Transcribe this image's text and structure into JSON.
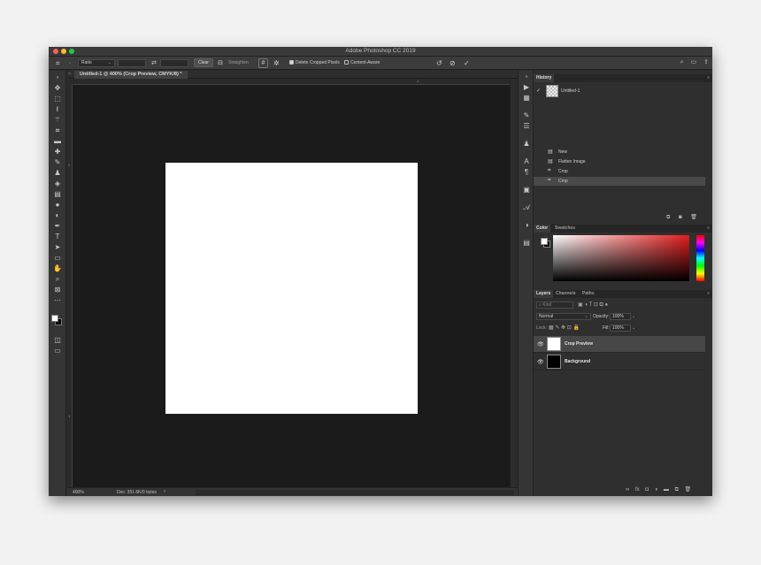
{
  "window": {
    "title": "Adobe Photoshop CC 2019"
  },
  "options_bar": {
    "ratio_label": "Ratio",
    "clear_label": "Clear",
    "straighten_label": "Straighten",
    "delete_cropped_label": "Delete Cropped Pixels",
    "delete_cropped_checked": true,
    "content_aware_label": "Content-Aware",
    "content_aware_checked": false
  },
  "document": {
    "tab_label": "Untitled-1 @ 400% (Crop Preview, CMYK/8) *",
    "ruler_h_mark": "1",
    "ruler_v_mark_top": "0",
    "ruler_v_mark_bottom": "1"
  },
  "status": {
    "zoom": "400%",
    "doc_size": "Doc: 351.6K/0 bytes"
  },
  "tools": [
    "move-tool-icon",
    "marquee-tool-icon",
    "lasso-tool-icon",
    "magic-wand-tool-icon",
    "crop-tool-icon",
    "ruler-tool-icon",
    "healing-brush-tool-icon",
    "brush-tool-icon",
    "clone-stamp-tool-icon",
    "eraser-tool-icon",
    "gradient-tool-icon",
    "blur-tool-icon",
    "dodge-tool-icon",
    "pen-tool-icon",
    "type-tool-icon",
    "path-selection-tool-icon",
    "rectangle-tool-icon",
    "hand-tool-icon",
    "zoom-tool-icon",
    "frame-tool-icon",
    "more-tools-icon"
  ],
  "history": {
    "title": "History",
    "snapshot_label": "Untitled-1",
    "items": [
      {
        "label": "New",
        "selected": false
      },
      {
        "label": "Flatten Image",
        "selected": false
      },
      {
        "label": "Crop",
        "selected": false
      },
      {
        "label": "Crop",
        "selected": true
      }
    ]
  },
  "color_panel": {
    "tab_color": "Color",
    "tab_swatches": "Swatches",
    "hue_color": "#e11c1c"
  },
  "layers_panel": {
    "tab_layers": "Layers",
    "tab_channels": "Channels",
    "tab_paths": "Paths",
    "filter_placeholder": "Kind",
    "blend_mode": "Normal",
    "opacity_label": "Opacity:",
    "opacity_value": "100%",
    "lock_label": "Lock:",
    "fill_label": "Fill:",
    "fill_value": "100%",
    "layers": [
      {
        "name": "Crop Preview",
        "thumb_color": "#ffffff",
        "selected": true
      },
      {
        "name": "Background",
        "thumb_color": "#000000",
        "selected": false
      }
    ]
  }
}
